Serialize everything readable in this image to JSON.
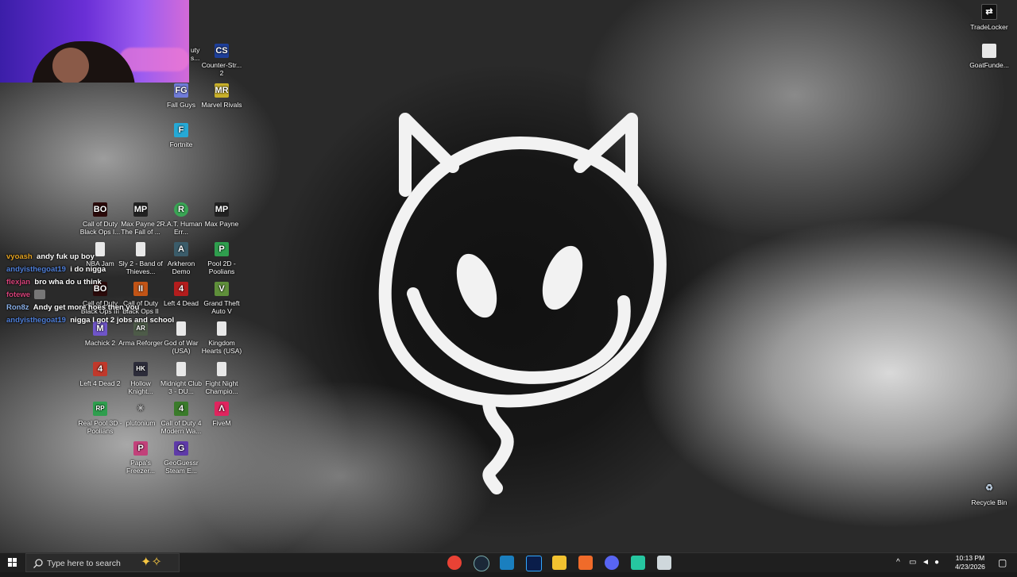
{
  "desktop": {
    "icons": [
      {
        "id": "cod-bo-top",
        "label": "Call of Duty Black Ops...",
        "color": "#222",
        "glyph": "CoD",
        "truncated_label": "uty\ns..."
      },
      {
        "id": "counter-strike",
        "label": "Counter-Str... 2",
        "color": "#1e3f99",
        "glyph": "CS"
      },
      {
        "id": "fall-guys",
        "label": "Fall Guys",
        "color": "#6f7bd8",
        "glyph": "FG"
      },
      {
        "id": "marvel-rivals",
        "label": "Marvel Rivals",
        "color": "#c8b02a",
        "glyph": "MR"
      },
      {
        "id": "fortnite",
        "label": "Fortnite",
        "color": "#25a9d6",
        "glyph": "F"
      },
      {
        "id": "cod-black-ops",
        "label": "Call of Duty Black Ops I...",
        "color": "#2b0a0a",
        "glyph": "BO"
      },
      {
        "id": "max-payne-2",
        "label": "Max Payne 2 The Fall of ...",
        "color": "#222",
        "glyph": "MP"
      },
      {
        "id": "rat-human-err",
        "label": "R.A.T. Human Err...",
        "color": "#3aa655",
        "glyph": "R"
      },
      {
        "id": "max-payne",
        "label": "Max Payne",
        "color": "#222",
        "glyph": "MP"
      },
      {
        "id": "nba-jam",
        "label": "NBA Jam",
        "color": "#e8e8e8",
        "glyph": ""
      },
      {
        "id": "sly-2",
        "label": "Sly 2 - Band of Thieves...",
        "color": "#e8e8e8",
        "glyph": ""
      },
      {
        "id": "arkheron-demo",
        "label": "Arkheron Demo",
        "color": "#3b5c6a",
        "glyph": "A"
      },
      {
        "id": "pool-2d",
        "label": "Pool 2D - Poolians",
        "color": "#2f9e4e",
        "glyph": "P"
      },
      {
        "id": "cod-black-ops-iii",
        "label": "Call of Duty Black Ops III",
        "color": "#2b0a0a",
        "glyph": "BO"
      },
      {
        "id": "cod-black-ops-ii",
        "label": "Call of Duty Black Ops II",
        "color": "#c25416",
        "glyph": "II"
      },
      {
        "id": "left-4-dead",
        "label": "Left 4 Dead",
        "color": "#b31d1d",
        "glyph": "4"
      },
      {
        "id": "gta-v",
        "label": "Grand Theft Auto V",
        "color": "#5f8f3a",
        "glyph": "V"
      },
      {
        "id": "machick-2",
        "label": "Machick 2",
        "color": "#6f55c9",
        "glyph": "M"
      },
      {
        "id": "arma-reforger",
        "label": "Arma Reforger",
        "color": "#4d5b48",
        "glyph": "AR"
      },
      {
        "id": "god-of-war",
        "label": "God of War (USA)",
        "color": "#e8e8e8",
        "glyph": ""
      },
      {
        "id": "kingdom-hearts",
        "label": "Kingdom Hearts (USA)",
        "color": "#e8e8e8",
        "glyph": ""
      },
      {
        "id": "left-4-dead-2",
        "label": "Left 4 Dead 2",
        "color": "#c0392b",
        "glyph": "4"
      },
      {
        "id": "hollow-knight",
        "label": "Hollow Knight...",
        "color": "#2c2c3a",
        "glyph": "HK"
      },
      {
        "id": "midnight-club-3",
        "label": "Midnight Club 3 - DU...",
        "color": "#e8e8e8",
        "glyph": ""
      },
      {
        "id": "fight-night",
        "label": "Fight Night Champio...",
        "color": "#e8e8e8",
        "glyph": ""
      },
      {
        "id": "real-pool-3d",
        "label": "Real Pool 3D - Poolians",
        "color": "#2f9e4e",
        "glyph": "RP"
      },
      {
        "id": "plutonium",
        "label": "plutonium",
        "color": "#555",
        "glyph": "✳"
      },
      {
        "id": "cod-4-mw",
        "label": "Call of Duty 4 Modern Wa...",
        "color": "#3a7b2a",
        "glyph": "4"
      },
      {
        "id": "fivem",
        "label": "FiveM",
        "color": "#e0245e",
        "glyph": "Λ"
      },
      {
        "id": "papas-freezeria",
        "label": "Papa's Freezer...",
        "color": "#c2417a",
        "glyph": "P"
      },
      {
        "id": "geoguessr",
        "label": "GeoGuessr Steam E...",
        "color": "#5e3aa8",
        "glyph": "G"
      },
      {
        "id": "tradelocker",
        "label": "TradeLocker",
        "color": "#111",
        "glyph": "⇄"
      },
      {
        "id": "goatfunded",
        "label": "GoatFunde...",
        "color": "#e8e8e8",
        "glyph": ""
      },
      {
        "id": "recycle-bin",
        "label": "Recycle Bin",
        "color": "#9bb",
        "glyph": "♻"
      }
    ]
  },
  "chat": [
    {
      "user": "vyoash",
      "user_color": "#e4a322",
      "message": "andy fuk up boy"
    },
    {
      "user": "andyisthegoat19",
      "user_color": "#4f7fd9",
      "message": "i do nigga"
    },
    {
      "user": "flexjan",
      "user_color": "#d8427a",
      "message": "bro wha do u think"
    },
    {
      "user": "fotewe",
      "user_color": "#d8427a",
      "message": ""
    },
    {
      "user": "Ron8z",
      "user_color": "#8ab0e8",
      "message": "Andy get more hoes then you"
    },
    {
      "user": "andyisthegoat19",
      "user_color": "#4f7fd9",
      "message": "nigga I got 2 jobs and school"
    }
  ],
  "taskbar": {
    "search_placeholder": "Type here to search",
    "apps": [
      {
        "name": "chrome",
        "color": "#e94235"
      },
      {
        "name": "steam",
        "color": "#1b2838"
      },
      {
        "name": "vs-code",
        "color": "#1a7fbf"
      },
      {
        "name": "photoshop",
        "color": "#0a1d4a"
      },
      {
        "name": "file-explorer",
        "color": "#f2c230"
      },
      {
        "name": "brave",
        "color": "#f06b2a"
      },
      {
        "name": "discord",
        "color": "#5865f2"
      },
      {
        "name": "spotify-like",
        "color": "#26c6a0"
      },
      {
        "name": "notepad",
        "color": "#cfd8dc"
      }
    ],
    "time": "10:13 PM",
    "date": "4/23/2026"
  }
}
